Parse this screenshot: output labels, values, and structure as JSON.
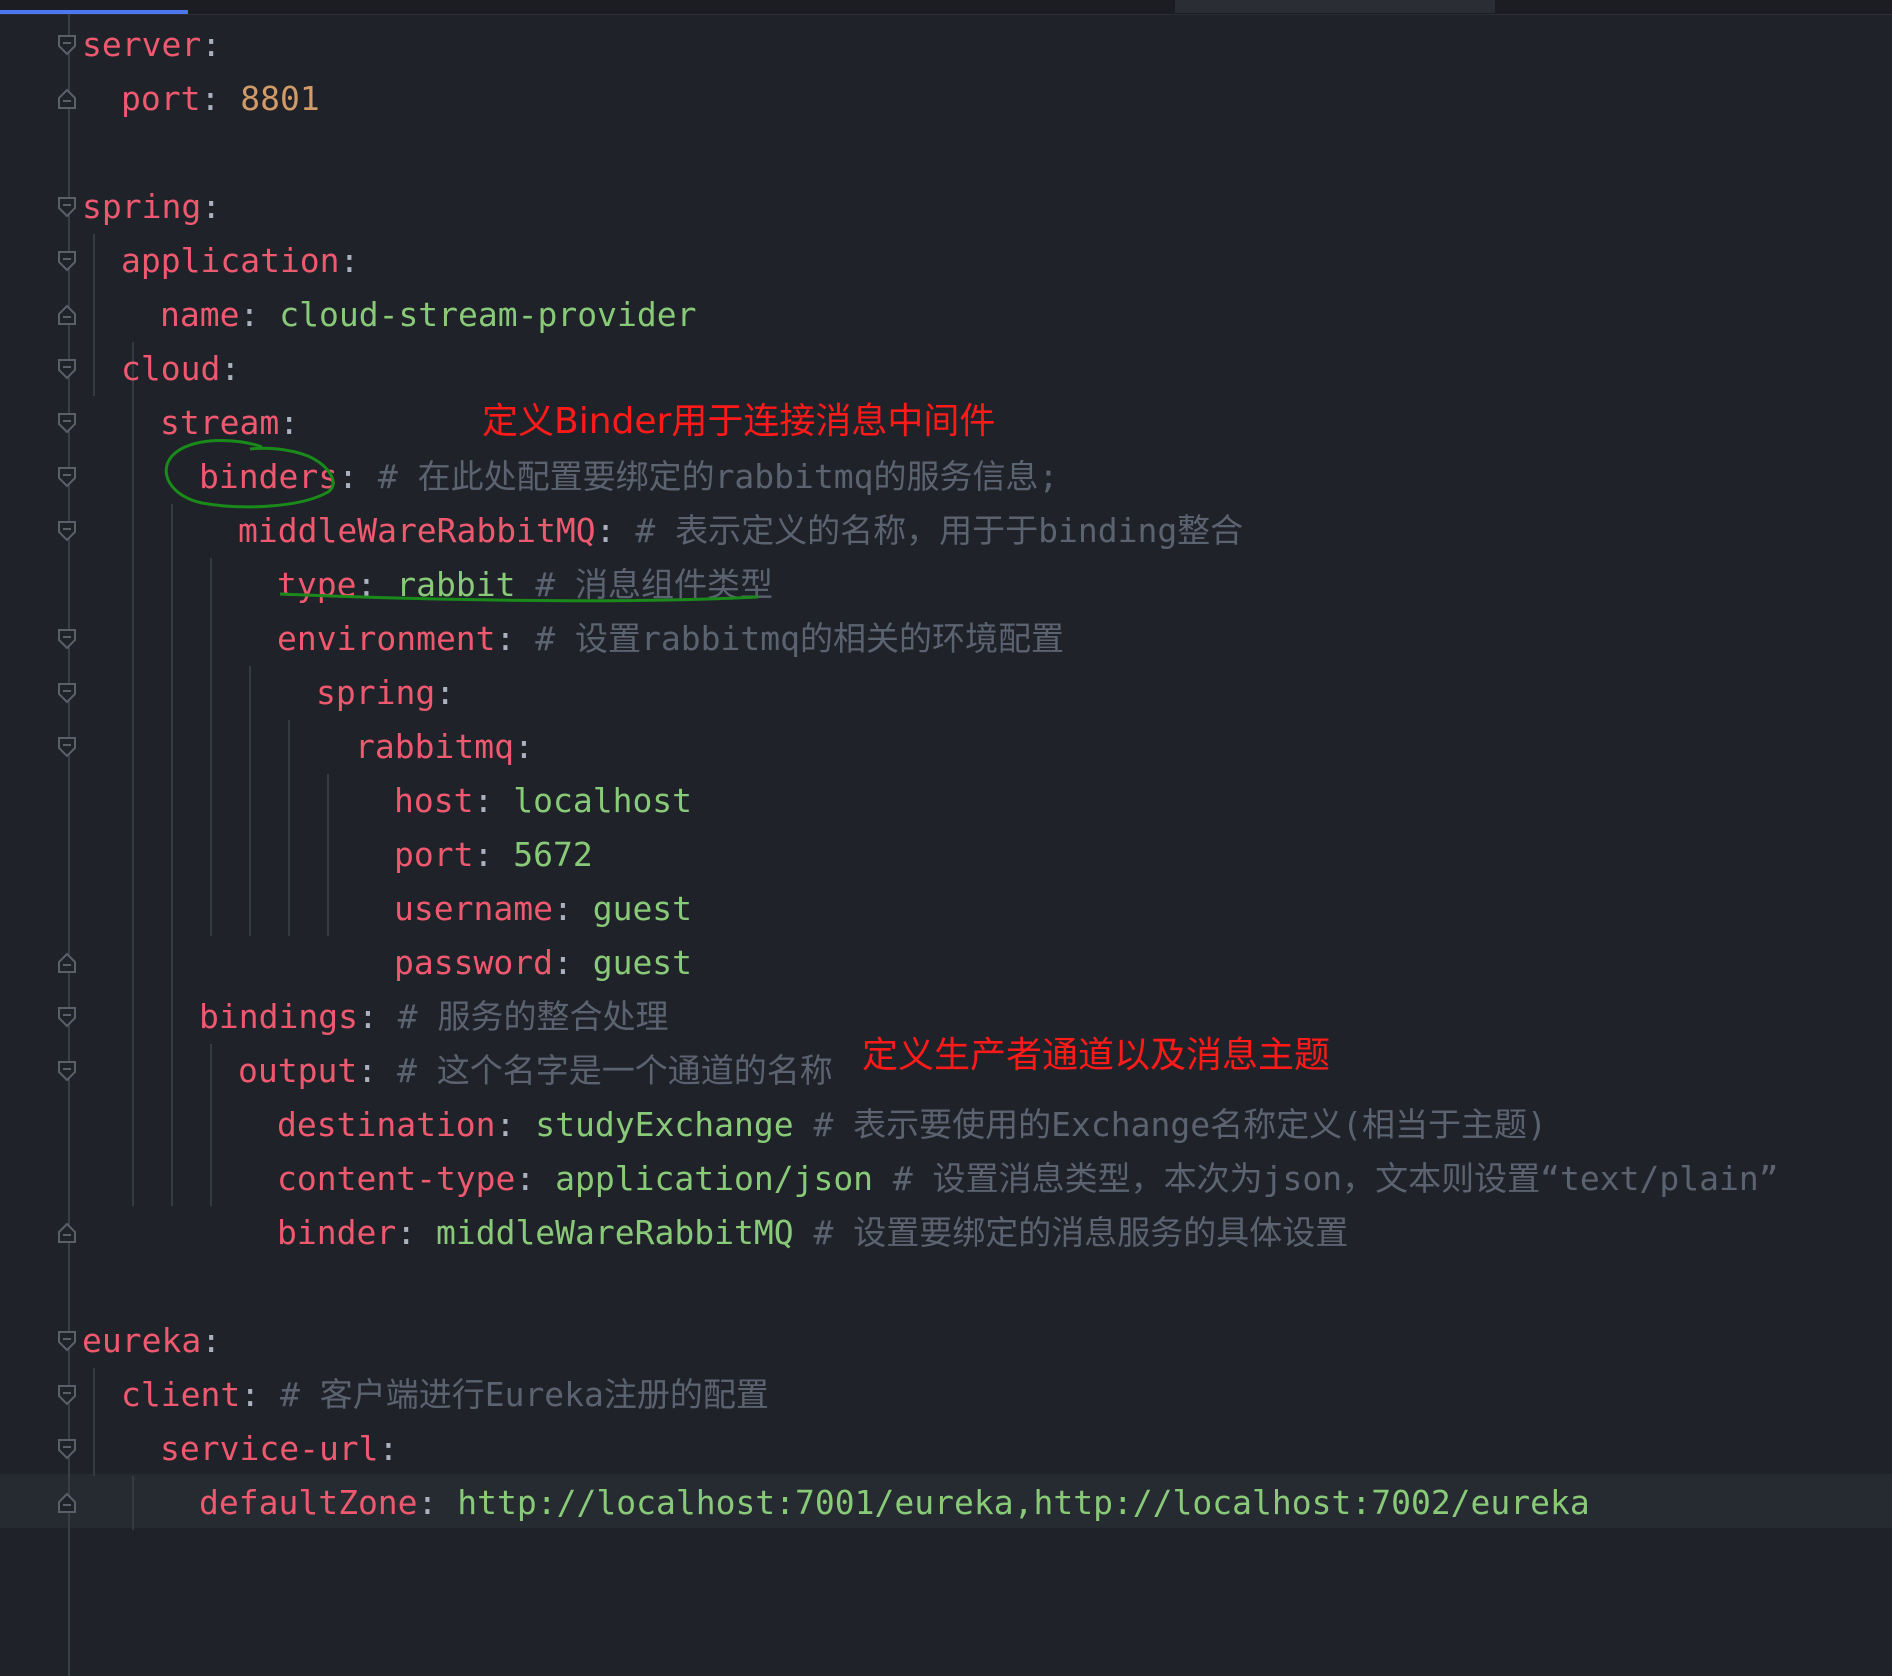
{
  "colors": {
    "background": "#1f2229",
    "key": "#ef596f",
    "string": "#89ca78",
    "number": "#d19a66",
    "comment": "#5c6370",
    "punctuation": "#abb2bf",
    "annotation_text": "#ff1a1a",
    "annotation_pen": "#1a8a1a",
    "active_tab": "#4c78ee"
  },
  "editor": {
    "lines": [
      {
        "key": "server",
        "sep": ":"
      },
      {
        "key": "port",
        "sep": ": ",
        "value": "8801"
      },
      {},
      {
        "key": "spring",
        "sep": ":"
      },
      {
        "key": "application",
        "sep": ":"
      },
      {
        "key": "name",
        "sep": ": ",
        "value": "cloud-stream-provider"
      },
      {
        "key": "cloud",
        "sep": ":"
      },
      {
        "key": "stream",
        "sep": ":"
      },
      {
        "key": "binders",
        "sep": ": ",
        "comment": "# 在此处配置要绑定的rabbitmq的服务信息;"
      },
      {
        "key": "middleWareRabbitMQ",
        "sep": ": ",
        "comment": "# 表示定义的名称，用于于binding整合"
      },
      {
        "key": "type",
        "sep": ": ",
        "value": "rabbit",
        "comment": " # 消息组件类型"
      },
      {
        "key": "environment",
        "sep": ": ",
        "comment": "# 设置rabbitmq的相关的环境配置"
      },
      {
        "key": "spring",
        "sep": ":"
      },
      {
        "key": "rabbitmq",
        "sep": ":"
      },
      {
        "key": "host",
        "sep": ": ",
        "value": "localhost"
      },
      {
        "key": "port",
        "sep": ": ",
        "value": "5672"
      },
      {
        "key": "username",
        "sep": ": ",
        "value": "guest"
      },
      {
        "key": "password",
        "sep": ": ",
        "value": "guest"
      },
      {
        "key": "bindings",
        "sep": ": ",
        "comment": "# 服务的整合处理"
      },
      {
        "key": "output",
        "sep": ": ",
        "comment": "# 这个名字是一个通道的名称"
      },
      {
        "key": "destination",
        "sep": ": ",
        "value": "studyExchange",
        "comment": " # 表示要使用的Exchange名称定义(相当于主题)"
      },
      {
        "key": "content-type",
        "sep": ": ",
        "value": "application/json",
        "comment": " # 设置消息类型，本次为json，文本则设置“text/plain”"
      },
      {
        "key": "binder",
        "sep": ": ",
        "value": "middleWareRabbitMQ",
        "comment": " # 设置要绑定的消息服务的具体设置"
      },
      {},
      {
        "key": "eureka",
        "sep": ":"
      },
      {
        "key": "client",
        "sep": ": ",
        "comment": "# 客户端进行Eureka注册的配置"
      },
      {
        "key": "service-url",
        "sep": ":"
      },
      {
        "key": "defaultZone",
        "sep": ": ",
        "value": "http://localhost:7001/eureka,http://localhost:7002/eureka"
      }
    ]
  },
  "annotations": {
    "binder_note": "定义Binder用于连接消息中间件",
    "output_note": "定义生产者通道以及消息主题"
  }
}
